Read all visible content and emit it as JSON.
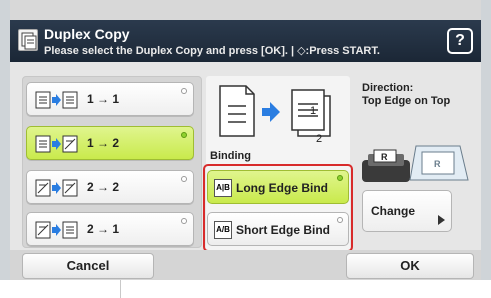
{
  "header": {
    "title": "Duplex Copy",
    "subtitle": "Please select the Duplex Copy and press [OK]. | ◇:Press START.",
    "help_label": "?"
  },
  "modes": [
    {
      "label": "1 → 1",
      "selected": false
    },
    {
      "label": "1 → 2",
      "selected": true
    },
    {
      "label": "2 → 2",
      "selected": false
    },
    {
      "label": "2 → 1",
      "selected": false
    }
  ],
  "preview": {
    "page_front": "1",
    "page_back": "2"
  },
  "binding": {
    "label": "Binding",
    "long_edge_label": "Long Edge Bind",
    "long_edge_icon": "A|B",
    "short_edge_label": "Short Edge Bind",
    "short_edge_icon": "A/B",
    "selected": "long"
  },
  "direction": {
    "heading": "Direction:",
    "value": "Top Edge on Top",
    "scanner_icon_letter_1": "R",
    "scanner_icon_letter_2": "R"
  },
  "buttons": {
    "change": "Change",
    "cancel": "Cancel",
    "ok": "OK"
  },
  "colors": {
    "header": "#1f2b3a",
    "selected": "#cdeb52",
    "highlight_border": "#d82b2b"
  }
}
